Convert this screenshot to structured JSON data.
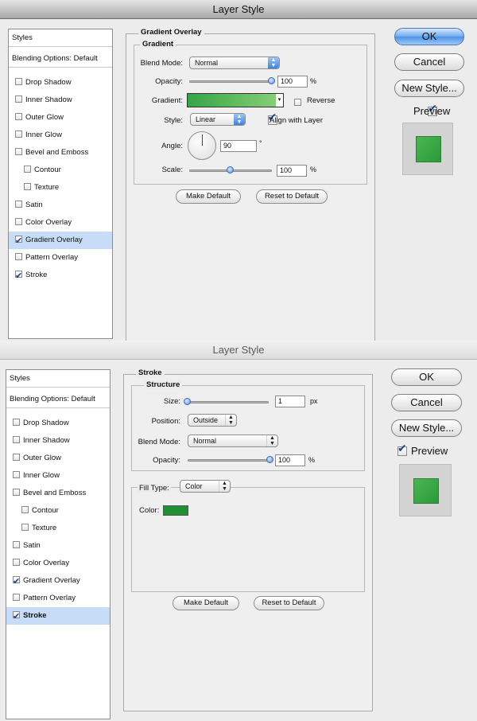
{
  "colors": {
    "gradient_start": "#35a445",
    "gradient_end": "#8cd27b",
    "stroke_color": "#1f8f33",
    "preview_green": "#3fae4a",
    "selection_bg": "#c7dcf6"
  },
  "dialog1": {
    "title": "Layer Style",
    "sidebar": {
      "styles": "Styles",
      "blending": "Blending Options: Default",
      "items": [
        {
          "label": "Drop Shadow",
          "checked": false,
          "indent": false,
          "selected": false
        },
        {
          "label": "Inner Shadow",
          "checked": false,
          "indent": false,
          "selected": false
        },
        {
          "label": "Outer Glow",
          "checked": false,
          "indent": false,
          "selected": false
        },
        {
          "label": "Inner Glow",
          "checked": false,
          "indent": false,
          "selected": false
        },
        {
          "label": "Bevel and Emboss",
          "checked": false,
          "indent": false,
          "selected": false
        },
        {
          "label": "Contour",
          "checked": false,
          "indent": true,
          "selected": false
        },
        {
          "label": "Texture",
          "checked": false,
          "indent": true,
          "selected": false
        },
        {
          "label": "Satin",
          "checked": false,
          "indent": false,
          "selected": false
        },
        {
          "label": "Color Overlay",
          "checked": false,
          "indent": false,
          "selected": false
        },
        {
          "label": "Gradient Overlay",
          "checked": true,
          "indent": false,
          "selected": true
        },
        {
          "label": "Pattern Overlay",
          "checked": false,
          "indent": false,
          "selected": false
        },
        {
          "label": "Stroke",
          "checked": true,
          "indent": false,
          "selected": false
        }
      ]
    },
    "panel_title": "Gradient Overlay",
    "group_title": "Gradient",
    "blend_mode_label": "Blend Mode:",
    "blend_mode_value": "Normal",
    "opacity_label": "Opacity:",
    "opacity_value": "100",
    "opacity_unit": "%",
    "opacity_level": 1.0,
    "gradient_label": "Gradient:",
    "reverse_label": "Reverse",
    "reverse_checked": false,
    "style_label": "Style:",
    "style_value": "Linear",
    "align_label": "Align with Layer",
    "align_checked": true,
    "angle_label": "Angle:",
    "angle_value": "90",
    "angle_unit": "°",
    "scale_label": "Scale:",
    "scale_value": "100",
    "scale_unit": "%",
    "scale_level": 0.5,
    "make_default": "Make Default",
    "reset_default": "Reset to Default",
    "ok": "OK",
    "cancel": "Cancel",
    "new_style": "New Style...",
    "preview_label": "Preview",
    "preview_checked": true
  },
  "dialog2": {
    "title": "Layer Style",
    "sidebar": {
      "styles": "Styles",
      "blending": "Blending Options: Default",
      "items": [
        {
          "label": "Drop Shadow",
          "checked": false,
          "indent": false,
          "selected": false
        },
        {
          "label": "Inner Shadow",
          "checked": false,
          "indent": false,
          "selected": false
        },
        {
          "label": "Outer Glow",
          "checked": false,
          "indent": false,
          "selected": false
        },
        {
          "label": "Inner Glow",
          "checked": false,
          "indent": false,
          "selected": false
        },
        {
          "label": "Bevel and Emboss",
          "checked": false,
          "indent": false,
          "selected": false
        },
        {
          "label": "Contour",
          "checked": false,
          "indent": true,
          "selected": false
        },
        {
          "label": "Texture",
          "checked": false,
          "indent": true,
          "selected": false
        },
        {
          "label": "Satin",
          "checked": false,
          "indent": false,
          "selected": false
        },
        {
          "label": "Color Overlay",
          "checked": false,
          "indent": false,
          "selected": false
        },
        {
          "label": "Gradient Overlay",
          "checked": true,
          "indent": false,
          "selected": false
        },
        {
          "label": "Pattern Overlay",
          "checked": false,
          "indent": false,
          "selected": false
        },
        {
          "label": "Stroke",
          "checked": true,
          "indent": false,
          "selected": true
        }
      ]
    },
    "panel_title": "Stroke",
    "group_title": "Structure",
    "size_label": "Size:",
    "size_value": "1",
    "size_unit": "px",
    "size_level": 0.0,
    "position_label": "Position:",
    "position_value": "Outside",
    "blend_mode_label": "Blend Mode:",
    "blend_mode_value": "Normal",
    "opacity_label": "Opacity:",
    "opacity_value": "100",
    "opacity_unit": "%",
    "opacity_level": 1.0,
    "fill_type_label": "Fill Type:",
    "fill_type_value": "Color",
    "color_label": "Color:",
    "make_default": "Make Default",
    "reset_default": "Reset to Default",
    "ok": "OK",
    "cancel": "Cancel",
    "new_style": "New Style...",
    "preview_label": "Preview",
    "preview_checked": true
  }
}
